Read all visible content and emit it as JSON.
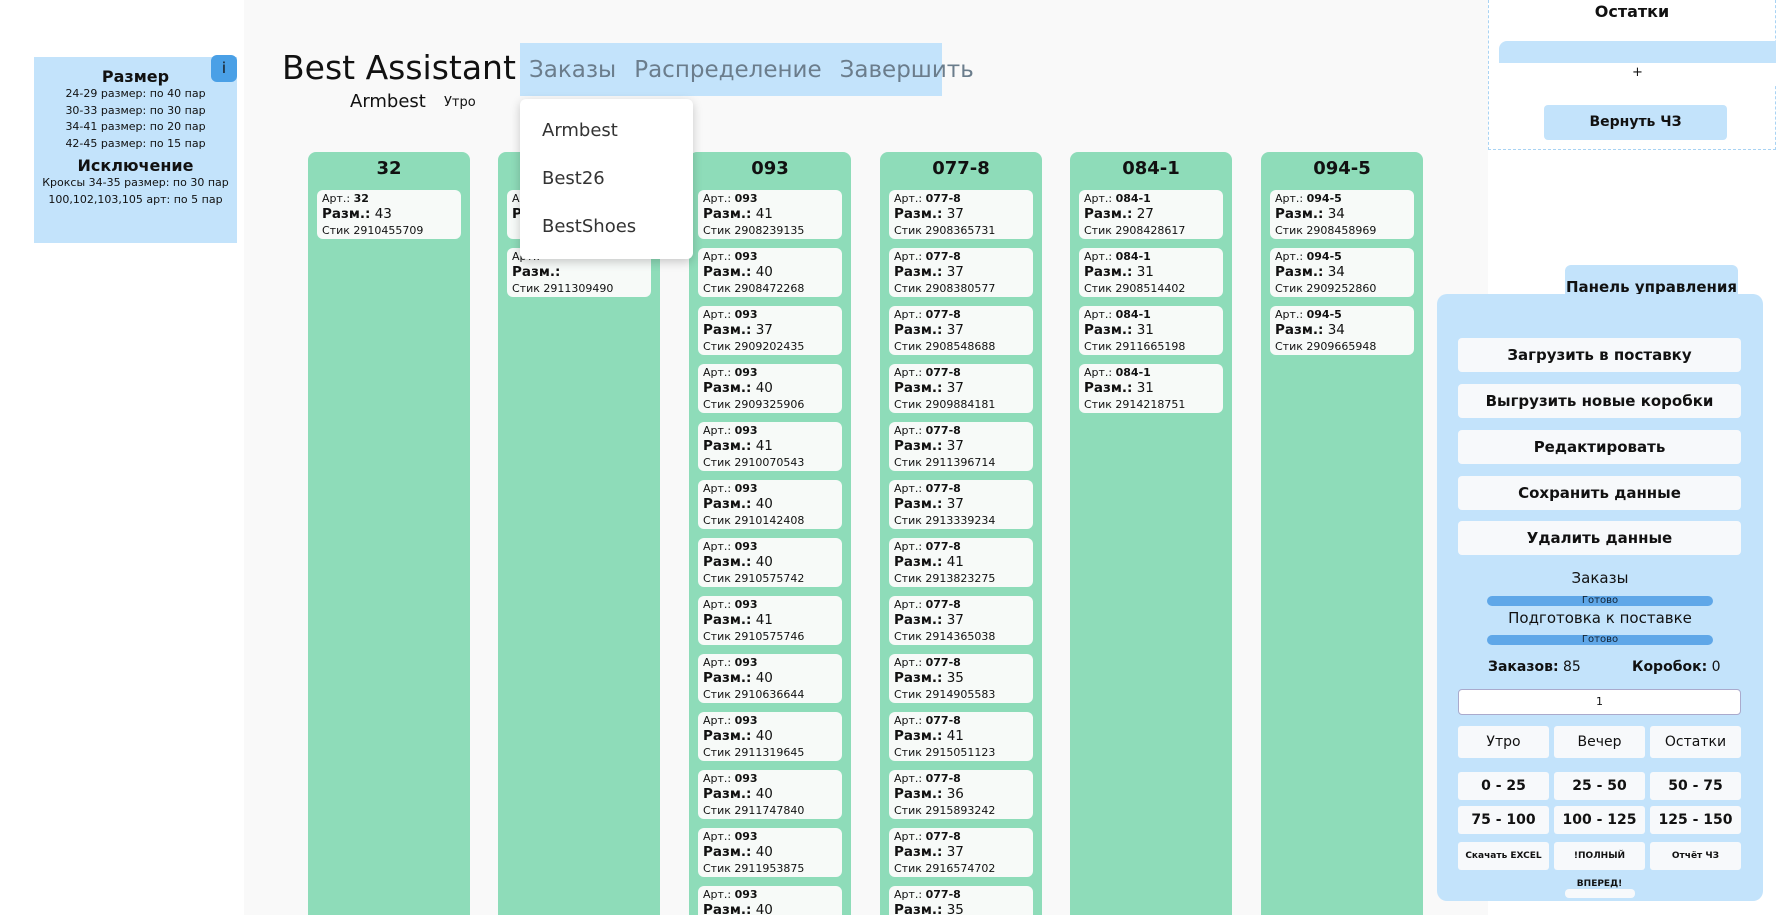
{
  "rules": {
    "title": "Размер",
    "lines": [
      "24-29 размер: по 40 пар",
      "30-33 размер: по 30 пар",
      "34-41 размер: по 20 пар",
      "42-45 размер: по 15 пар"
    ],
    "exception_title": "Исключение",
    "exception_lines": [
      "Кроксы 34-35 размер: по 30 пар",
      "100,102,103,105 арт: по 5 пар"
    ],
    "info_label": "i"
  },
  "header": {
    "brand": "Best Assistant",
    "company": "Armbest",
    "shift": "Утро",
    "nav": [
      "Заказы",
      "Распределение",
      "Завершить"
    ]
  },
  "dropdown": [
    "Armbest",
    "Best26",
    "BestShoes"
  ],
  "columns": [
    {
      "title": "32",
      "cards": [
        {
          "art": "32",
          "size": "43",
          "stick": "Стик 2910455709"
        }
      ]
    },
    {
      "title": "",
      "cards": [
        {
          "art": "",
          "size": "",
          "stick": ""
        },
        {
          "art": "",
          "size": "",
          "stick": "Стик 2911309490"
        }
      ]
    },
    {
      "title": "093",
      "cards": [
        {
          "art": "093",
          "size": "41",
          "stick": "Стик 2908239135"
        },
        {
          "art": "093",
          "size": "40",
          "stick": "Стик 2908472268"
        },
        {
          "art": "093",
          "size": "37",
          "stick": "Стик 2909202435"
        },
        {
          "art": "093",
          "size": "40",
          "stick": "Стик 2909325906"
        },
        {
          "art": "093",
          "size": "41",
          "stick": "Стик 2910070543"
        },
        {
          "art": "093",
          "size": "40",
          "stick": "Стик 2910142408"
        },
        {
          "art": "093",
          "size": "40",
          "stick": "Стик 2910575742"
        },
        {
          "art": "093",
          "size": "41",
          "stick": "Стик 2910575746"
        },
        {
          "art": "093",
          "size": "40",
          "stick": "Стик 2910636644"
        },
        {
          "art": "093",
          "size": "40",
          "stick": "Стик 2911319645"
        },
        {
          "art": "093",
          "size": "40",
          "stick": "Стик 2911747840"
        },
        {
          "art": "093",
          "size": "40",
          "stick": "Стик 2911953875"
        },
        {
          "art": "093",
          "size": "40",
          "stick": ""
        }
      ]
    },
    {
      "title": "077-8",
      "cards": [
        {
          "art": "077-8",
          "size": "37",
          "stick": "Стик 2908365731"
        },
        {
          "art": "077-8",
          "size": "37",
          "stick": "Стик 2908380577"
        },
        {
          "art": "077-8",
          "size": "37",
          "stick": "Стик 2908548688"
        },
        {
          "art": "077-8",
          "size": "37",
          "stick": "Стик 2909884181"
        },
        {
          "art": "077-8",
          "size": "37",
          "stick": "Стик 2911396714"
        },
        {
          "art": "077-8",
          "size": "37",
          "stick": "Стик 2913339234"
        },
        {
          "art": "077-8",
          "size": "41",
          "stick": "Стик 2913823275"
        },
        {
          "art": "077-8",
          "size": "37",
          "stick": "Стик 2914365038"
        },
        {
          "art": "077-8",
          "size": "35",
          "stick": "Стик 2914905583"
        },
        {
          "art": "077-8",
          "size": "41",
          "stick": "Стик 2915051123"
        },
        {
          "art": "077-8",
          "size": "36",
          "stick": "Стик 2915893242"
        },
        {
          "art": "077-8",
          "size": "37",
          "stick": "Стик 2916574702"
        },
        {
          "art": "077-8",
          "size": "35",
          "stick": ""
        }
      ]
    },
    {
      "title": "084-1",
      "cards": [
        {
          "art": "084-1",
          "size": "27",
          "stick": "Стик 2908428617"
        },
        {
          "art": "084-1",
          "size": "31",
          "stick": "Стик 2908514402"
        },
        {
          "art": "084-1",
          "size": "31",
          "stick": "Стик 2911665198"
        },
        {
          "art": "084-1",
          "size": "31",
          "stick": "Стик 2914218751"
        }
      ]
    },
    {
      "title": "094-5",
      "cards": [
        {
          "art": "094-5",
          "size": "34",
          "stick": "Стик 2908458969"
        },
        {
          "art": "094-5",
          "size": "34",
          "stick": "Стик 2909252860"
        },
        {
          "art": "094-5",
          "size": "34",
          "stick": "Стик 2909665948"
        }
      ]
    }
  ],
  "labels": {
    "art": "Арт.:",
    "size": "Разм.:"
  },
  "ostatki": {
    "title": "Остатки",
    "plus": "+",
    "return_button": "Вернуть ЧЗ"
  },
  "control_panel": {
    "tab": "Панель управления",
    "buttons": [
      "Загрузить в поставку",
      "Выгрузить новые коробки",
      "Редактировать",
      "Сохранить данные",
      "Удалить данные"
    ],
    "orders_label": "Заказы",
    "orders_status": "Готово",
    "prep_label": "Подготовка к поставке",
    "prep_status": "Готово",
    "orders_count_label": "Заказов:",
    "orders_count": "85",
    "boxes_label": "Коробок:",
    "boxes_count": "0",
    "input_value": "1",
    "shift_buttons": [
      "Утро",
      "Вечер",
      "Остатки"
    ],
    "range_buttons": [
      "0 - 25",
      "25 - 50",
      "50 - 75",
      "75 - 100",
      "100 - 125",
      "125 - 150"
    ],
    "bottom_buttons": [
      "Скачать EXCEL",
      "!ПОЛНЫЙ ВПЕРЕД!",
      "Отчёт ЧЗ"
    ]
  }
}
